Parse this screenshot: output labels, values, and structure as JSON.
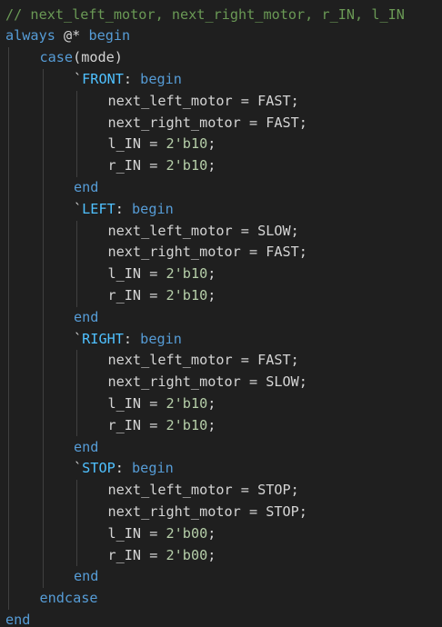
{
  "editor": {
    "colors": {
      "background": "#1f1f1f",
      "keyword": "#569cd6",
      "comment": "#6a9955",
      "macro": "#4fc1ff",
      "text": "#d4d4d4",
      "number": "#b5cea8",
      "indent_guide": "#404040"
    },
    "lines": [
      {
        "indent": 0,
        "tokens": [
          {
            "t": "// next_left_motor, next_right_motor, r_IN, l_IN",
            "c": "cmt"
          }
        ]
      },
      {
        "indent": 0,
        "tokens": [
          {
            "t": "always",
            "c": "kw"
          },
          {
            "t": " @* ",
            "c": "txt"
          },
          {
            "t": "begin",
            "c": "kw"
          }
        ]
      },
      {
        "indent": 1,
        "tokens": [
          {
            "t": "case",
            "c": "kw"
          },
          {
            "t": "(mode)",
            "c": "txt"
          }
        ]
      },
      {
        "indent": 2,
        "tokens": [
          {
            "t": "`",
            "c": "tick"
          },
          {
            "t": "FRONT",
            "c": "mac"
          },
          {
            "t": ": ",
            "c": "txt"
          },
          {
            "t": "begin",
            "c": "kw"
          }
        ]
      },
      {
        "indent": 3,
        "tokens": [
          {
            "t": "next_left_motor = FAST;",
            "c": "txt"
          }
        ]
      },
      {
        "indent": 3,
        "tokens": [
          {
            "t": "next_right_motor = FAST;",
            "c": "txt"
          }
        ]
      },
      {
        "indent": 3,
        "tokens": [
          {
            "t": "l_IN = ",
            "c": "txt"
          },
          {
            "t": "2'b10",
            "c": "num"
          },
          {
            "t": ";",
            "c": "txt"
          }
        ]
      },
      {
        "indent": 3,
        "tokens": [
          {
            "t": "r_IN = ",
            "c": "txt"
          },
          {
            "t": "2'b10",
            "c": "num"
          },
          {
            "t": ";",
            "c": "txt"
          }
        ]
      },
      {
        "indent": 2,
        "tokens": [
          {
            "t": "end",
            "c": "kw"
          }
        ]
      },
      {
        "indent": 2,
        "tokens": [
          {
            "t": "`",
            "c": "tick"
          },
          {
            "t": "LEFT",
            "c": "mac"
          },
          {
            "t": ": ",
            "c": "txt"
          },
          {
            "t": "begin",
            "c": "kw"
          }
        ]
      },
      {
        "indent": 3,
        "tokens": [
          {
            "t": "next_left_motor = SLOW;",
            "c": "txt"
          }
        ]
      },
      {
        "indent": 3,
        "tokens": [
          {
            "t": "next_right_motor = FAST;",
            "c": "txt"
          }
        ]
      },
      {
        "indent": 3,
        "tokens": [
          {
            "t": "l_IN = ",
            "c": "txt"
          },
          {
            "t": "2'b10",
            "c": "num"
          },
          {
            "t": ";",
            "c": "txt"
          }
        ]
      },
      {
        "indent": 3,
        "tokens": [
          {
            "t": "r_IN = ",
            "c": "txt"
          },
          {
            "t": "2'b10",
            "c": "num"
          },
          {
            "t": ";",
            "c": "txt"
          }
        ]
      },
      {
        "indent": 2,
        "tokens": [
          {
            "t": "end",
            "c": "kw"
          }
        ]
      },
      {
        "indent": 2,
        "tokens": [
          {
            "t": "`",
            "c": "tick"
          },
          {
            "t": "RIGHT",
            "c": "mac"
          },
          {
            "t": ": ",
            "c": "txt"
          },
          {
            "t": "begin",
            "c": "kw"
          }
        ]
      },
      {
        "indent": 3,
        "tokens": [
          {
            "t": "next_left_motor = FAST;",
            "c": "txt"
          }
        ]
      },
      {
        "indent": 3,
        "tokens": [
          {
            "t": "next_right_motor = SLOW;",
            "c": "txt"
          }
        ]
      },
      {
        "indent": 3,
        "tokens": [
          {
            "t": "l_IN = ",
            "c": "txt"
          },
          {
            "t": "2'b10",
            "c": "num"
          },
          {
            "t": ";",
            "c": "txt"
          }
        ]
      },
      {
        "indent": 3,
        "tokens": [
          {
            "t": "r_IN = ",
            "c": "txt"
          },
          {
            "t": "2'b10",
            "c": "num"
          },
          {
            "t": ";",
            "c": "txt"
          }
        ]
      },
      {
        "indent": 2,
        "tokens": [
          {
            "t": "end",
            "c": "kw"
          }
        ]
      },
      {
        "indent": 2,
        "tokens": [
          {
            "t": "`",
            "c": "tick"
          },
          {
            "t": "STOP",
            "c": "mac"
          },
          {
            "t": ": ",
            "c": "txt"
          },
          {
            "t": "begin",
            "c": "kw"
          }
        ]
      },
      {
        "indent": 3,
        "tokens": [
          {
            "t": "next_left_motor = STOP;",
            "c": "txt"
          }
        ]
      },
      {
        "indent": 3,
        "tokens": [
          {
            "t": "next_right_motor = STOP;",
            "c": "txt"
          }
        ]
      },
      {
        "indent": 3,
        "tokens": [
          {
            "t": "l_IN = ",
            "c": "txt"
          },
          {
            "t": "2'b00",
            "c": "num"
          },
          {
            "t": ";",
            "c": "txt"
          }
        ]
      },
      {
        "indent": 3,
        "tokens": [
          {
            "t": "r_IN = ",
            "c": "txt"
          },
          {
            "t": "2'b00",
            "c": "num"
          },
          {
            "t": ";",
            "c": "txt"
          }
        ]
      },
      {
        "indent": 2,
        "tokens": [
          {
            "t": "end",
            "c": "kw"
          }
        ]
      },
      {
        "indent": 1,
        "tokens": [
          {
            "t": "endcase",
            "c": "kw"
          }
        ]
      },
      {
        "indent": 0,
        "tokens": [
          {
            "t": "end",
            "c": "kw"
          }
        ]
      }
    ]
  }
}
